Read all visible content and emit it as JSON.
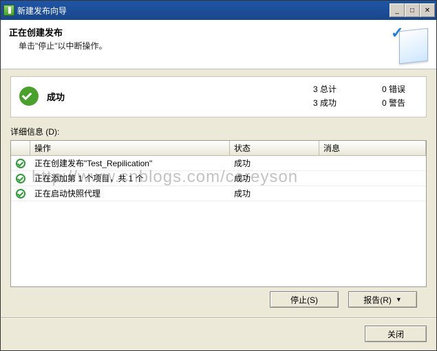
{
  "window": {
    "title": "新建发布向导"
  },
  "header": {
    "title": "正在创建发布",
    "subtitle": "单击\"停止\"以中断操作。"
  },
  "summary": {
    "status_label": "成功",
    "stats": {
      "total": "3  总计",
      "success": "3  成功",
      "errors": "0  错误",
      "warnings": "0  警告"
    }
  },
  "details": {
    "label": "详细信息 (D):",
    "columns": {
      "operation": "操作",
      "status": "状态",
      "message": "消息"
    },
    "rows": [
      {
        "op": "正在创建发布\"Test_Repilication\"",
        "status": "成功",
        "msg": ""
      },
      {
        "op": "正在添加第 1 个项目，共 1 个",
        "status": "成功",
        "msg": ""
      },
      {
        "op": "正在启动快照代理",
        "status": "成功",
        "msg": ""
      }
    ]
  },
  "buttons": {
    "stop": "停止(S)",
    "report": "报告(R)",
    "close": "关闭"
  },
  "watermark": "http://www.cnblogs.com/careyson"
}
